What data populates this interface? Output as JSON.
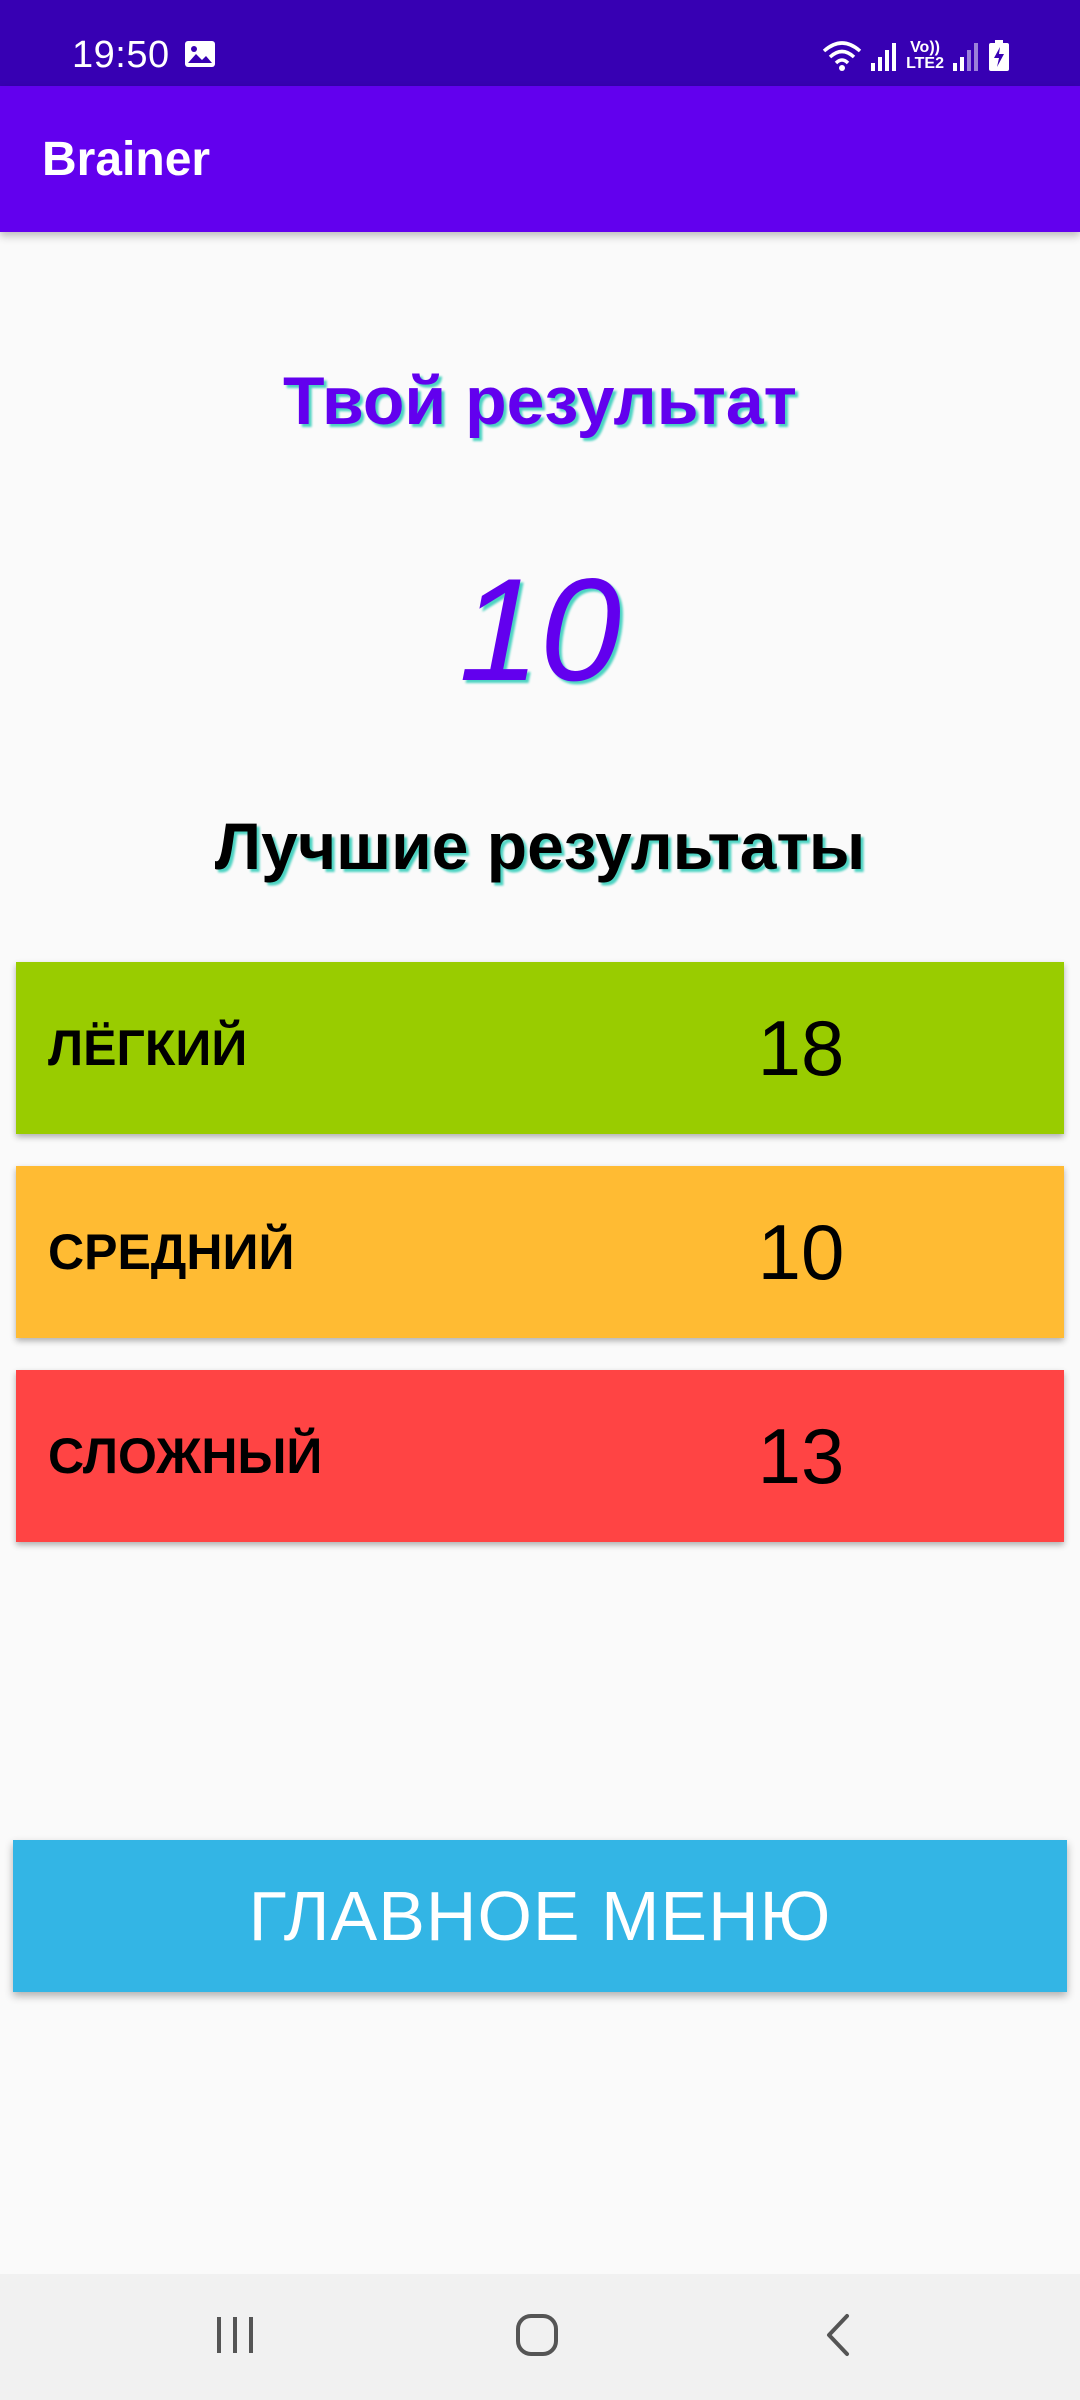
{
  "status_bar": {
    "time": "19:50",
    "network_label_top": "Vo))",
    "network_label_bottom": "LTE2"
  },
  "app_bar": {
    "title": "Brainer",
    "color": "#6200ee"
  },
  "result": {
    "title": "Твой результат",
    "score": "10"
  },
  "best_results": {
    "title": "Лучшие результаты",
    "rows": [
      {
        "label": "ЛЁГКИЙ",
        "value": "18",
        "color": "#99cc00"
      },
      {
        "label": "СРЕДНИЙ",
        "value": "10",
        "color": "#ffbb33"
      },
      {
        "label": "СЛОЖНЫЙ",
        "value": "13",
        "color": "#ff4444"
      }
    ]
  },
  "main_menu_button": {
    "label": "ГЛАВНОЕ МЕНЮ",
    "color": "#33b5e5"
  },
  "nav_bar": {
    "icons": [
      "recent-apps-icon",
      "home-icon",
      "back-icon"
    ]
  }
}
